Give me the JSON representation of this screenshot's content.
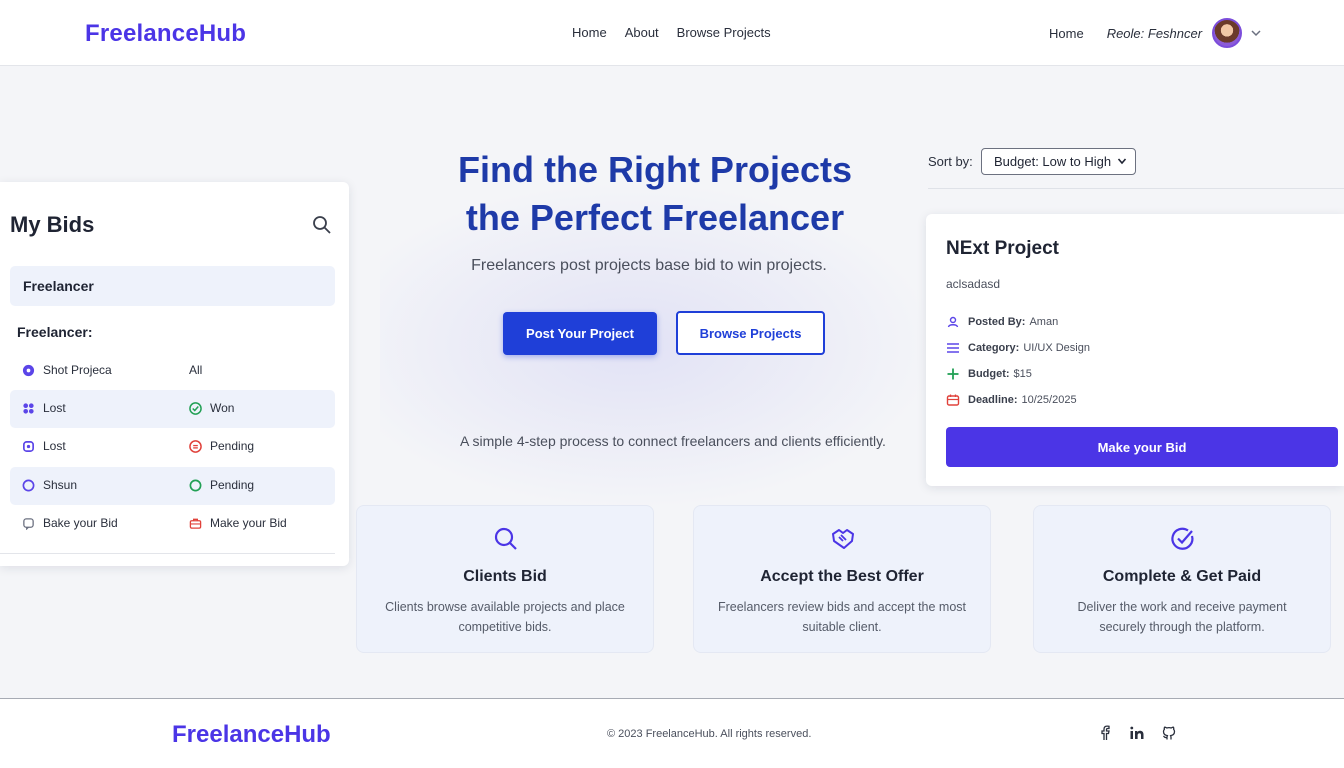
{
  "nav": {
    "brand": "FreelanceHub",
    "links": [
      "Home",
      "About",
      "Browse Projects"
    ],
    "right_link": "Home",
    "role_label": "Reole: Feshncer"
  },
  "hero": {
    "title_line1": "Find the Right Projects",
    "title_line2": "the Perfect Freelancer",
    "subtitle": "Freelancers post projects base bid to win projects.",
    "primary_button": "Post Your Project",
    "secondary_button": "Browse Projects",
    "process_text": "A simple 4-step process to connect freelancers and clients efficiently."
  },
  "bids": {
    "title": "My Bids",
    "selected": "Freelancer",
    "group_label": "Freelancer:",
    "rows": [
      {
        "left": "Shot Projeca",
        "left_icon": "dot-icon",
        "right": "All",
        "right_icon": ""
      },
      {
        "left": "Lost",
        "left_icon": "flower-icon",
        "right": "Won",
        "right_icon": "check-circle-icon"
      },
      {
        "left": "Lost",
        "left_icon": "cog-icon",
        "right": "Pending",
        "right_icon": "clock-circle-icon"
      },
      {
        "left": "Shsun",
        "left_icon": "circle-icon",
        "right": "Pending",
        "right_icon": "circle-outline-icon"
      },
      {
        "left": "Bake your Bid",
        "left_icon": "chat-icon",
        "right": "Make your Bid",
        "right_icon": "bag-icon"
      }
    ]
  },
  "sort": {
    "label": "Sort by:",
    "value": "Budget: Low to High"
  },
  "project": {
    "title": "NExt Project",
    "description": "aclsadasd",
    "posted_by_label": "Posted By:",
    "posted_by": "Aman",
    "category_label": "Category:",
    "category": "UI/UX Design",
    "budget_label": "Budget:",
    "budget": "$15",
    "deadline_label": "Deadline:",
    "deadline": "10/25/2025",
    "button": "Make your Bid"
  },
  "steps": [
    {
      "title": "Clients Bid",
      "desc": "Clients browse available projects and place competitive bids.",
      "icon": "search-icon"
    },
    {
      "title": "Accept the Best Offer",
      "desc": "Freelancers review bids and accept the most suitable client.",
      "icon": "handshake-icon"
    },
    {
      "title": "Complete & Get Paid",
      "desc": "Deliver the work and receive payment securely through the platform.",
      "icon": "check-badge-icon"
    }
  ],
  "footer": {
    "brand": "FreelanceHub",
    "copyright": "© 2023 FreelanceHub. All rights reserved.",
    "socials": [
      "facebook-icon",
      "linkedin-icon",
      "github-icon"
    ]
  },
  "colors": {
    "brand": "#4b35e6",
    "primary": "#1f3fd8",
    "hero_title": "#1e3aa8",
    "panel_tint": "#eef2fb"
  }
}
